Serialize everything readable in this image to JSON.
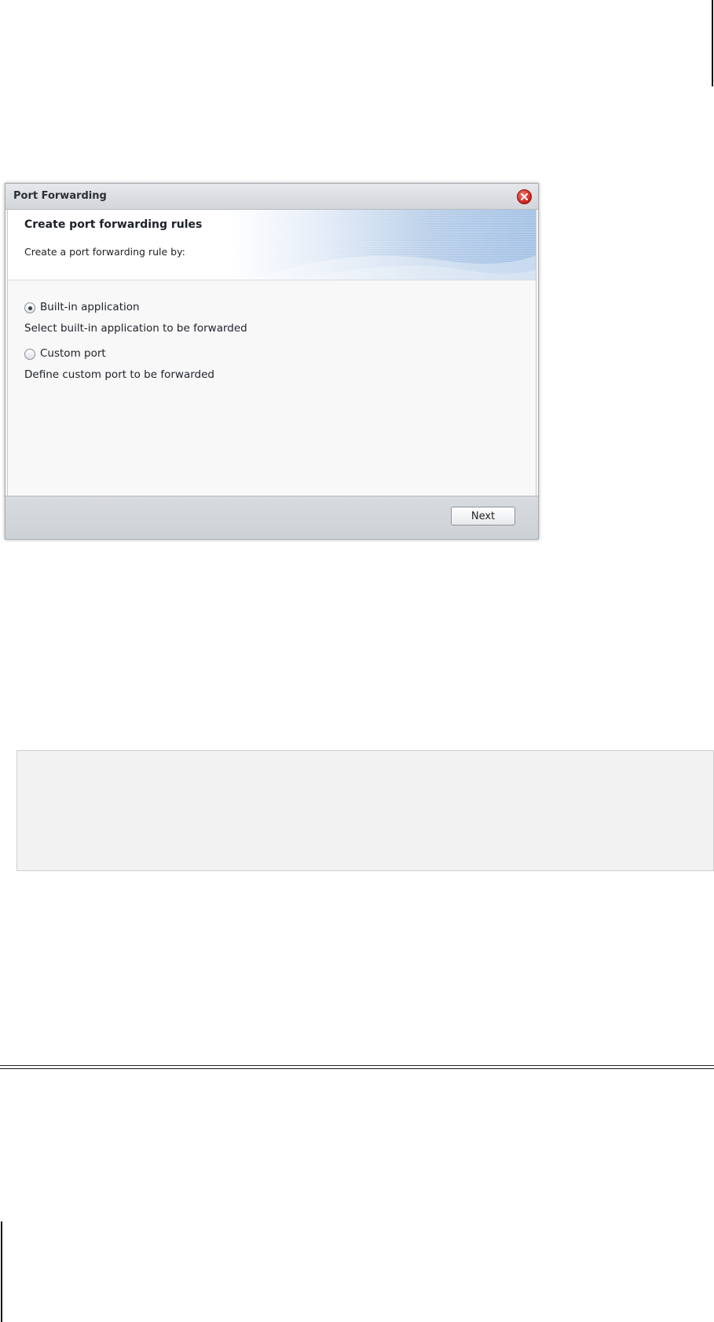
{
  "dialog": {
    "title": "Port Forwarding",
    "banner_title": "Create port forwarding rules",
    "banner_subtitle": "Create a port forwarding rule by:",
    "options": [
      {
        "label": "Built-in application",
        "description": "Select built-in application to be forwarded",
        "selected": true
      },
      {
        "label": "Custom port",
        "description": "Define custom port to be forwarded",
        "selected": false
      }
    ],
    "next_label": "Next",
    "close_icon": "close-icon"
  },
  "colors": {
    "close_button": "#d0261c",
    "banner_accent": "#a5c2e6",
    "footer": "#d3d6da"
  }
}
